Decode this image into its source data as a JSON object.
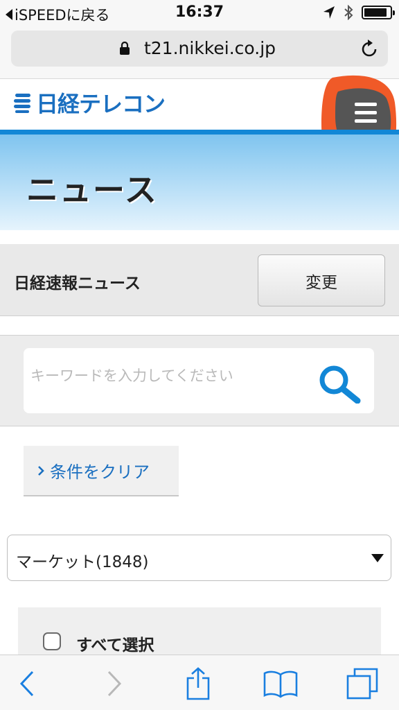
{
  "status_bar": {
    "back_label": "iSPEEDに戻る",
    "time": "16:37",
    "battery_level": 0.9
  },
  "browser": {
    "url": "t21.nikkei.co.jp"
  },
  "header": {
    "logo_text": "日経テレコン"
  },
  "banner": {
    "title": "ニュース"
  },
  "source": {
    "label": "日経速報ニュース",
    "change_label": "変更"
  },
  "search": {
    "placeholder": "キーワードを入力してください",
    "value": ""
  },
  "clear": {
    "label": "条件をクリア"
  },
  "category": {
    "selected": "マーケット(1848)"
  },
  "select_all": {
    "label": "すべて選択",
    "checked": false
  },
  "colors": {
    "brand_blue": "#1a6fc0",
    "accent_blue": "#1287d6",
    "highlight_orange": "#f05a28"
  },
  "icons": [
    "signal-arrow-icon",
    "bluetooth-icon",
    "battery-icon",
    "lock-icon",
    "reload-icon",
    "hamburger-menu-icon",
    "search-icon",
    "chevron-right-icon",
    "back-icon",
    "forward-icon",
    "share-icon",
    "bookmarks-icon",
    "tabs-icon"
  ]
}
